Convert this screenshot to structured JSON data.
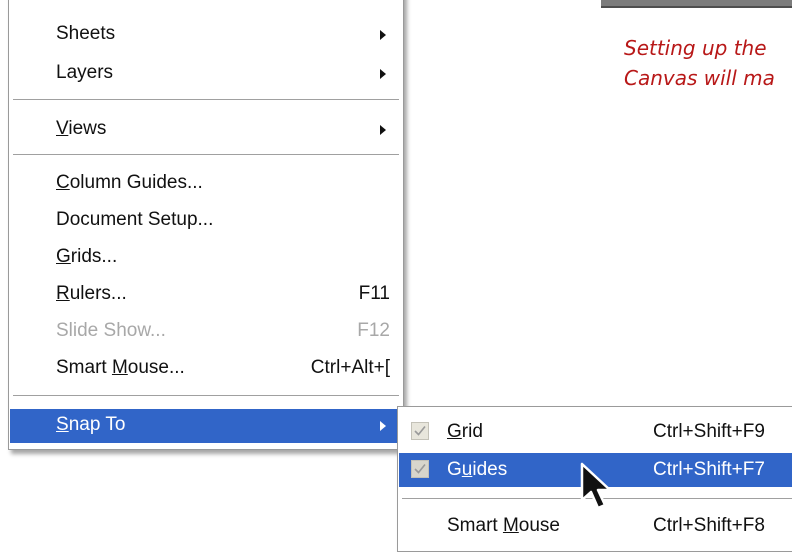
{
  "menu": {
    "items": [
      {
        "label": "Sheets",
        "submenu": true
      },
      {
        "label": "Layers",
        "submenu": true
      },
      {
        "label": "Views",
        "mnemonic": "V",
        "submenu": true
      },
      {
        "label": "Column Guides...",
        "mnemonic": "C"
      },
      {
        "label": "Document Setup..."
      },
      {
        "label": "Grids...",
        "mnemonic": "G"
      },
      {
        "label": "Rulers...",
        "mnemonic": "R",
        "shortcut": "F11"
      },
      {
        "label": "Slide Show...",
        "shortcut": "F12",
        "disabled": true
      },
      {
        "label": "Smart Mouse...",
        "mnemonic": "M",
        "shortcut": "Ctrl+Alt+["
      },
      {
        "label": "Snap To",
        "mnemonic": "S",
        "submenu": true,
        "highlighted": true
      }
    ]
  },
  "submenu": {
    "items": [
      {
        "label": "Grid",
        "shortcut": "Ctrl+Shift+F9",
        "checked": true
      },
      {
        "label": "Guides",
        "shortcut": "Ctrl+Shift+F7",
        "checked": true,
        "highlighted": true
      },
      {
        "label": "Smart Mouse",
        "shortcut": "Ctrl+Shift+F8",
        "checked": false
      }
    ]
  },
  "caption": {
    "line1": "Setting up the",
    "line2": "Canvas will ma"
  },
  "colors": {
    "highlight": "#3165c8",
    "caption": "#b81818"
  }
}
